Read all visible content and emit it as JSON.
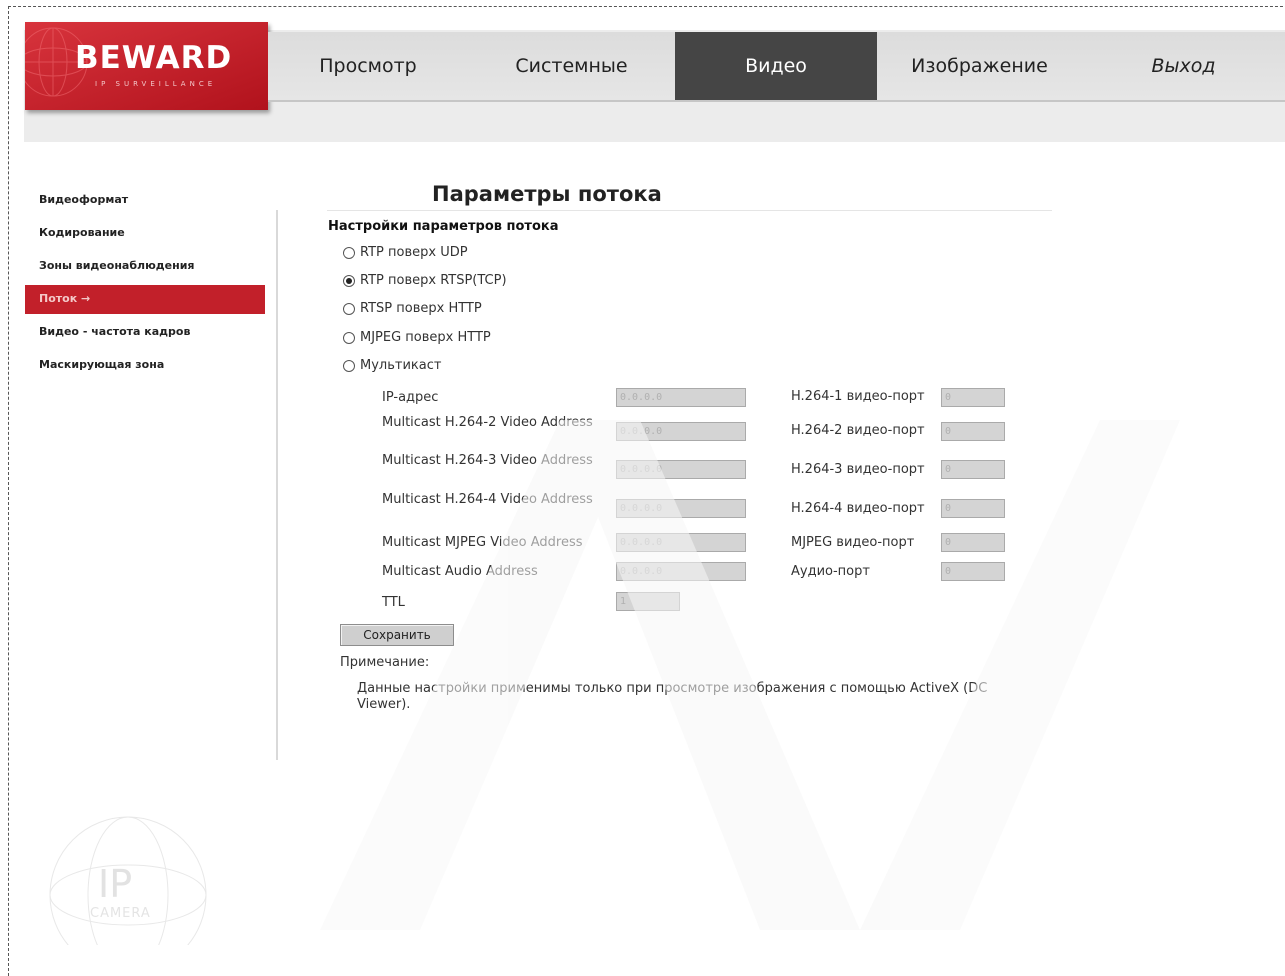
{
  "brand": {
    "logo_text": "BEWARD",
    "logo_sub": "IP SURVEILLANCE"
  },
  "topnav": {
    "items": [
      {
        "label": "Просмотр",
        "active": false
      },
      {
        "label": "Системные",
        "active": false
      },
      {
        "label": "Видео",
        "active": true
      },
      {
        "label": "Изображение",
        "active": false
      },
      {
        "label": "Выход",
        "active": false
      }
    ]
  },
  "sidebar": {
    "items": [
      {
        "label": "Видеоформат"
      },
      {
        "label": "Кодирование"
      },
      {
        "label": "Зоны видеонаблюдения"
      },
      {
        "label": "Поток →",
        "active": true
      },
      {
        "label": "Видео - частота кадров"
      },
      {
        "label": "Маскирующая зона"
      }
    ]
  },
  "main": {
    "title": "Параметры потока",
    "section_title": "Настройки параметров потока",
    "protocols": [
      {
        "label": "RTP поверх UDP",
        "checked": false
      },
      {
        "label": "RTP поверх RTSP(TCP)",
        "checked": true
      },
      {
        "label": "RTSP поверх HTTP",
        "checked": false
      },
      {
        "label": "MJPEG поверх HTTP",
        "checked": false
      },
      {
        "label": "Мультикаст",
        "checked": false
      }
    ],
    "multicast": {
      "rows": [
        {
          "label": "IP-адрес",
          "address": "0.0.0.0",
          "port_label": "H.264-1 видео-порт",
          "port": "0"
        },
        {
          "label": "Multicast H.264-2 Video Address",
          "address": "0.0.0.0",
          "port_label": "H.264-2 видео-порт",
          "port": "0"
        },
        {
          "label": "Multicast H.264-3 Video Address",
          "address": "0.0.0.0",
          "port_label": "H.264-3 видео-порт",
          "port": "0"
        },
        {
          "label": "Multicast H.264-4 Video Address",
          "address": "0.0.0.0",
          "port_label": "H.264-4 видео-порт",
          "port": "0"
        },
        {
          "label": "Multicast MJPEG Video Address",
          "address": "0.0.0.0",
          "port_label": "MJPEG видео-порт",
          "port": "0"
        },
        {
          "label": "Multicast Audio Address",
          "address": "0.0.0.0",
          "port_label": "Аудио-порт",
          "port": "0"
        }
      ],
      "ttl_label": "TTL",
      "ttl": "1"
    },
    "save_label": "Сохранить",
    "note_label": "Примечание:",
    "note_text": "Данные настройки применимы только при просмотре изображения с помощью ActiveX (DC Viewer)."
  },
  "badge": {
    "ip": "IP",
    "camera": "CAMERA"
  },
  "colors": {
    "accent": "#c2202a",
    "nav_active": "#454545",
    "input_bg": "#d4d4d4"
  }
}
